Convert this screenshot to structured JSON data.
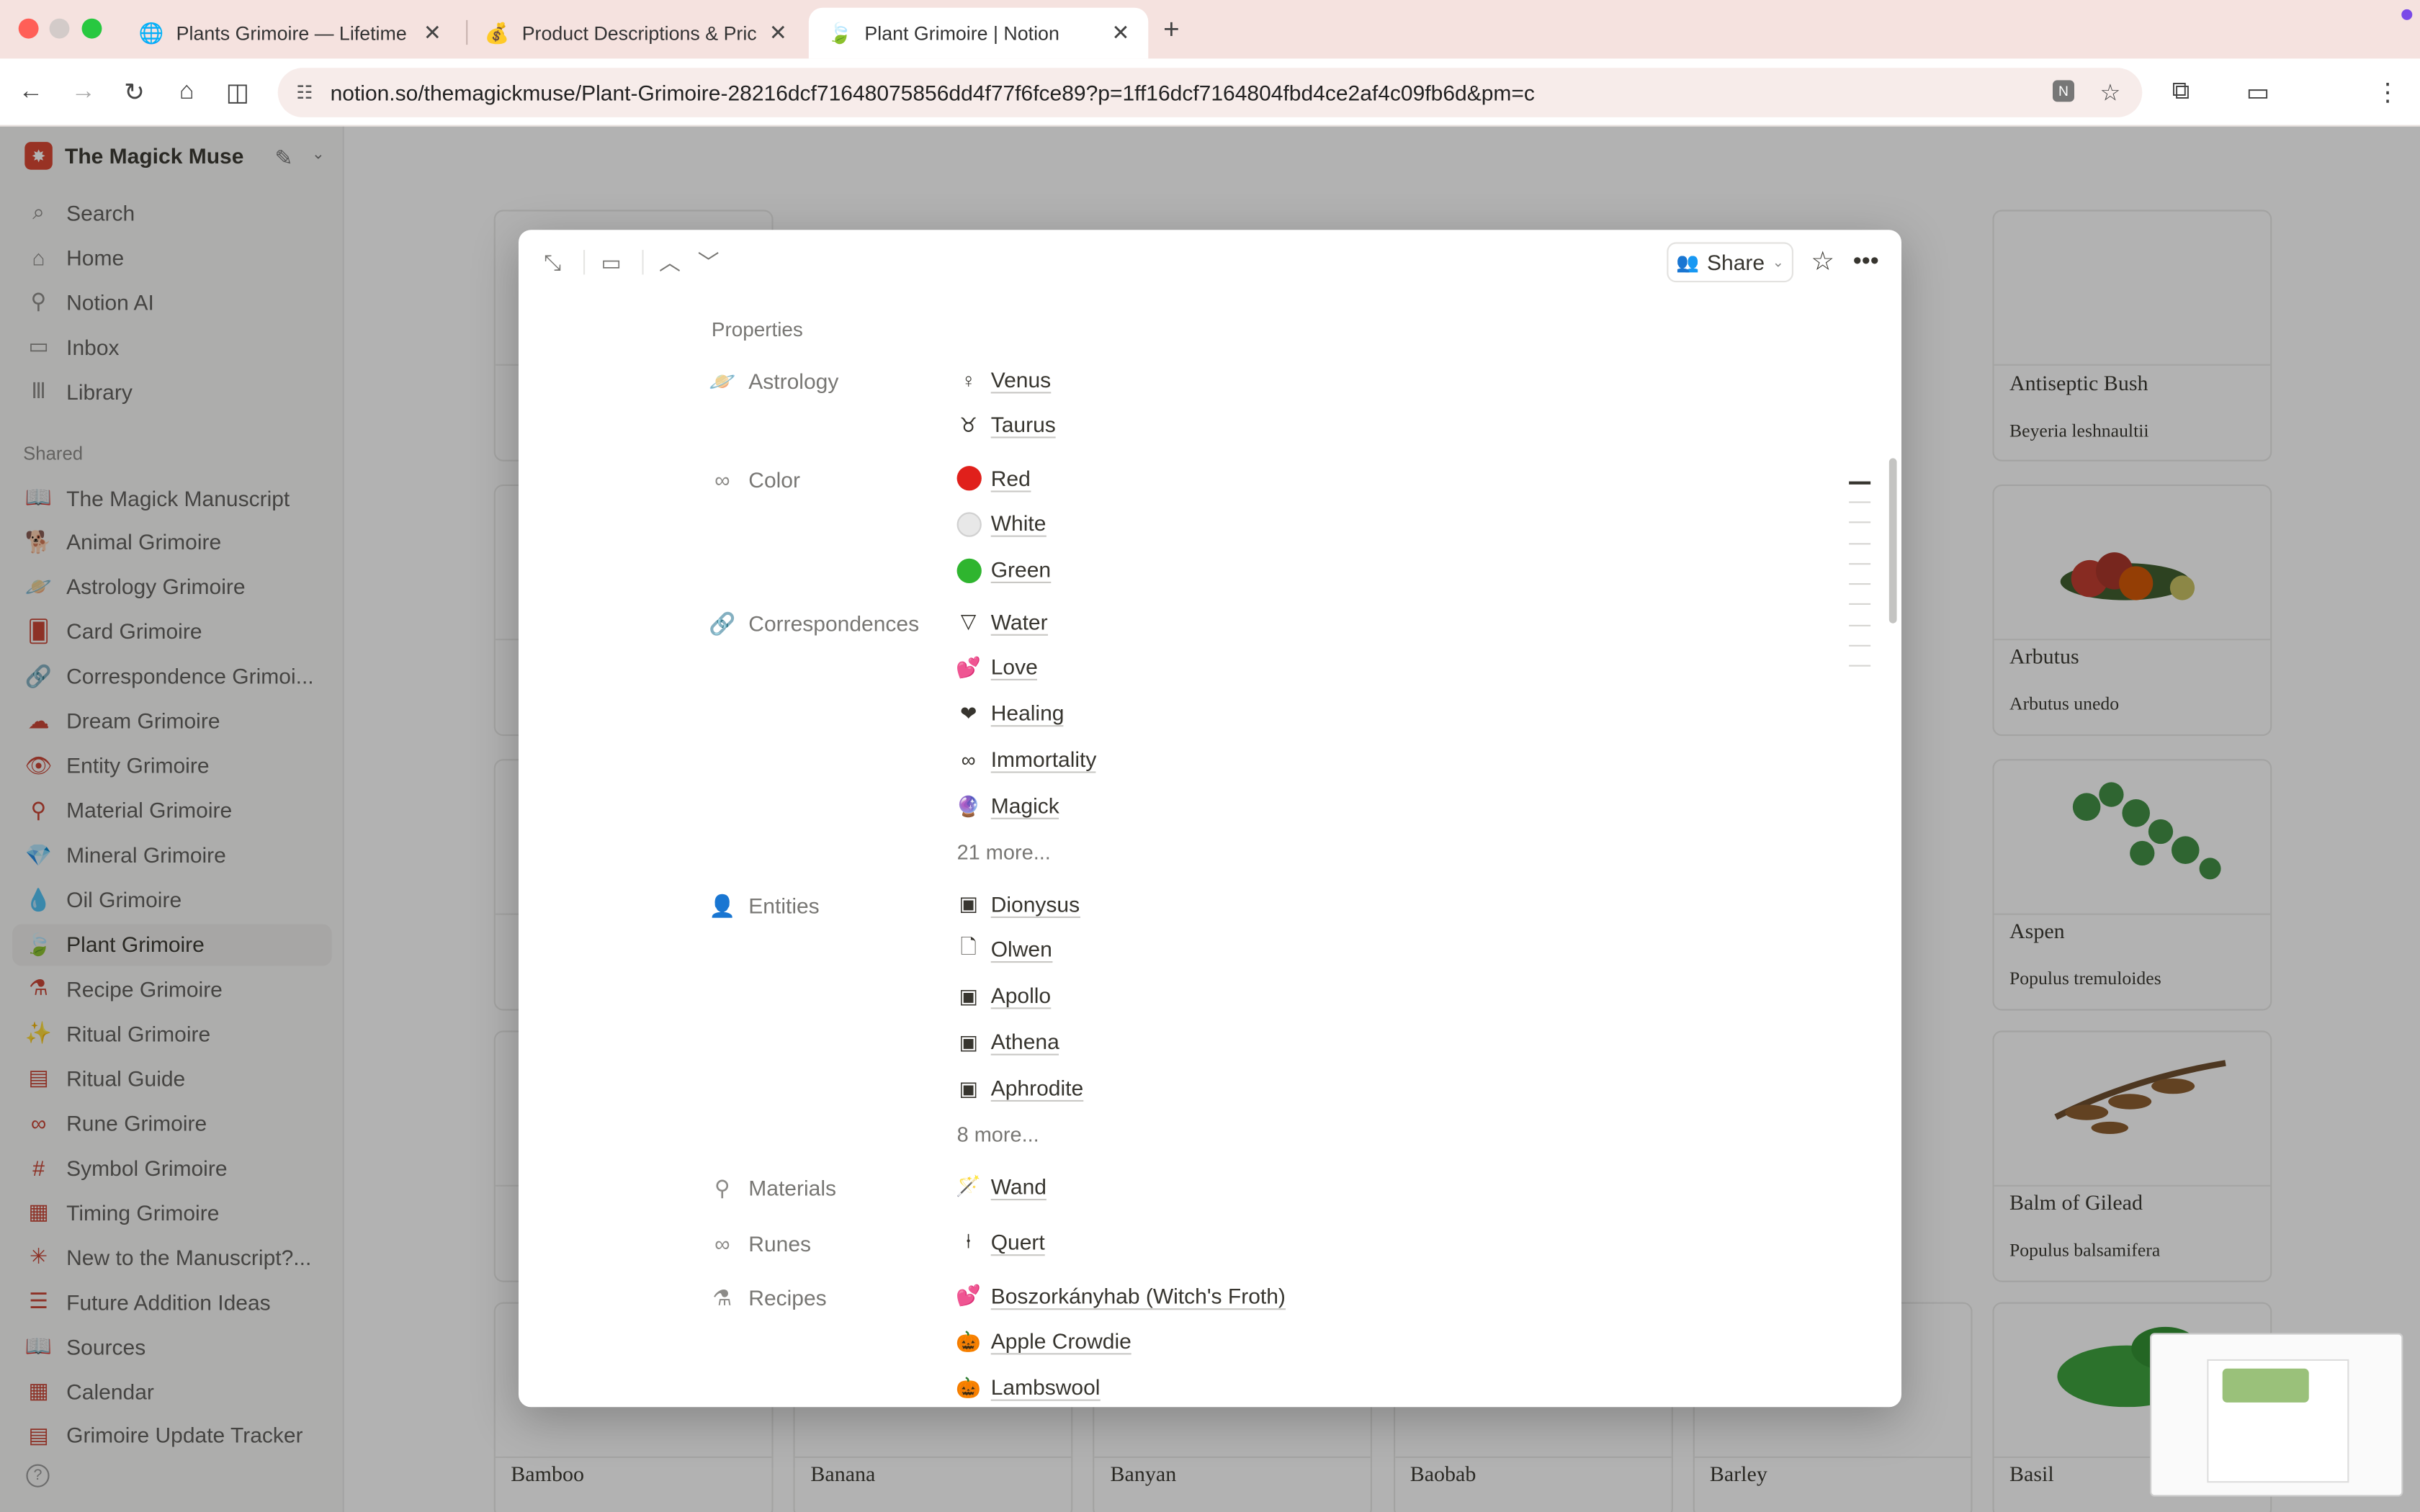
{
  "browser": {
    "tabs": [
      {
        "title": "Plants Grimoire — Lifetime Ac",
        "icon": "globe-icon"
      },
      {
        "title": "Product Descriptions & Pricin",
        "icon": "money-bag-icon"
      },
      {
        "title": "Plant Grimoire | Notion",
        "icon": "leaf-icon"
      }
    ],
    "url": "notion.so/themagickmuse/Plant-Grimoire-28216dcf71648075856dd4f77f6fce89?p=1ff16dcf7164804fbd4ce2af4c09fb6d&pm=c"
  },
  "sidebar": {
    "workspace": "The Magick Muse",
    "nav": [
      {
        "label": "Search",
        "icon": "search-icon",
        "glyph": "⌕"
      },
      {
        "label": "Home",
        "icon": "home-icon",
        "glyph": "⌂"
      },
      {
        "label": "Notion AI",
        "icon": "ai-icon",
        "glyph": "⚲"
      },
      {
        "label": "Inbox",
        "icon": "inbox-icon",
        "glyph": "▭"
      },
      {
        "label": "Library",
        "icon": "library-icon",
        "glyph": "Ⅲ"
      }
    ],
    "shared_label": "Shared",
    "pages": [
      {
        "label": "The Magick Manuscript",
        "icon": "book-icon",
        "glyph": "📖"
      },
      {
        "label": "Animal Grimoire",
        "icon": "animal-icon",
        "glyph": "🐕"
      },
      {
        "label": "Astrology Grimoire",
        "icon": "planet-icon",
        "glyph": "🪐"
      },
      {
        "label": "Card Grimoire",
        "icon": "card-icon",
        "glyph": "🂠"
      },
      {
        "label": "Correspondence Grimoi...",
        "icon": "link-icon",
        "glyph": "🔗"
      },
      {
        "label": "Dream Grimoire",
        "icon": "cloud-icon",
        "glyph": "☁"
      },
      {
        "label": "Entity Grimoire",
        "icon": "eye-icon",
        "glyph": "👁"
      },
      {
        "label": "Material Grimoire",
        "icon": "wand-icon",
        "glyph": "⚲"
      },
      {
        "label": "Mineral Grimoire",
        "icon": "gem-icon",
        "glyph": "💎"
      },
      {
        "label": "Oil Grimoire",
        "icon": "drop-icon",
        "glyph": "💧"
      },
      {
        "label": "Plant Grimoire",
        "icon": "leaf-icon",
        "glyph": "🍃",
        "selected": true
      },
      {
        "label": "Recipe Grimoire",
        "icon": "flask-icon",
        "glyph": "⚗"
      },
      {
        "label": "Ritual Grimoire",
        "icon": "magic-wand-icon",
        "glyph": "✨"
      },
      {
        "label": "Ritual Guide",
        "icon": "page-icon",
        "glyph": "▤"
      },
      {
        "label": "Rune Grimoire",
        "icon": "infinity-icon",
        "glyph": "∞"
      },
      {
        "label": "Symbol Grimoire",
        "icon": "hash-icon",
        "glyph": "#"
      },
      {
        "label": "Timing Grimoire",
        "icon": "calendar-icon",
        "glyph": "▦"
      },
      {
        "label": "New to the Manuscript?...",
        "icon": "sparkle-icon",
        "glyph": "✳"
      },
      {
        "label": "Future Addition Ideas",
        "icon": "list-icon",
        "glyph": "☰"
      },
      {
        "label": "Sources",
        "icon": "open-book-icon",
        "glyph": "📖"
      },
      {
        "label": "Calendar",
        "icon": "calendar-icon",
        "glyph": "▦"
      },
      {
        "label": "Grimoire Update Tracker",
        "icon": "table-icon",
        "glyph": "▤"
      }
    ]
  },
  "gallery": {
    "right_cards": [
      {
        "title": "Antiseptic Bush",
        "sub": "Beyeria leshnaultii"
      },
      {
        "title": "Arbutus",
        "sub": "Arbutus unedo"
      },
      {
        "title": "Aspen",
        "sub": "Populus tremuloides"
      },
      {
        "title": "Balm of Gilead",
        "sub": "Populus balsamifera"
      }
    ],
    "bottom_cards": [
      "Bamboo",
      "Banana",
      "Banyan",
      "Baobab",
      "Barley",
      "Basil"
    ]
  },
  "modal": {
    "share_label": "Share",
    "properties_heading": "Properties",
    "properties": [
      {
        "label": "Astrology",
        "icon": "planet-icon",
        "glyph": "🪐",
        "values": [
          {
            "text": "Venus",
            "glyph": "♀",
            "icon": "venus-icon"
          },
          {
            "text": "Taurus",
            "glyph": "♉",
            "icon": "taurus-icon"
          }
        ]
      },
      {
        "label": "Color",
        "icon": "infinity-icon",
        "glyph": "∞",
        "values": [
          {
            "text": "Red",
            "color": "#e0201b",
            "icon": "red-circle-icon"
          },
          {
            "text": "White",
            "color": "#e8e8e8",
            "icon": "white-circle-icon"
          },
          {
            "text": "Green",
            "color": "#2fb52f",
            "icon": "green-circle-icon"
          }
        ]
      },
      {
        "label": "Correspondences",
        "icon": "link-icon",
        "glyph": "🔗",
        "values": [
          {
            "text": "Water",
            "glyph": "▽",
            "icon": "water-triangle-icon"
          },
          {
            "text": "Love",
            "glyph": "💕",
            "icon": "hearts-icon"
          },
          {
            "text": "Healing",
            "glyph": "❤",
            "icon": "mending-heart-icon"
          },
          {
            "text": "Immortality",
            "glyph": "∞",
            "icon": "infinity-icon"
          },
          {
            "text": "Magick",
            "glyph": "🔮",
            "icon": "crystal-ball-icon"
          }
        ],
        "more": "21 more..."
      },
      {
        "label": "Entities",
        "icon": "person-icon",
        "glyph": "👤",
        "values": [
          {
            "text": "Dionysus",
            "glyph": "▣",
            "icon": "portrait-icon"
          },
          {
            "text": "Olwen",
            "glyph": "🗋",
            "icon": "page-icon"
          },
          {
            "text": "Apollo",
            "glyph": "▣",
            "icon": "portrait-icon"
          },
          {
            "text": "Athena",
            "glyph": "▣",
            "icon": "portrait-icon"
          },
          {
            "text": "Aphrodite",
            "glyph": "▣",
            "icon": "portrait-icon"
          }
        ],
        "more": "8 more..."
      },
      {
        "label": "Materials",
        "icon": "wand-icon",
        "glyph": "⚲",
        "values": [
          {
            "text": "Wand",
            "glyph": "🪄",
            "icon": "wand-icon"
          }
        ]
      },
      {
        "label": "Runes",
        "icon": "infinity-icon",
        "glyph": "∞",
        "values": [
          {
            "text": "Quert",
            "glyph": "⍿",
            "icon": "rune-icon"
          }
        ]
      },
      {
        "label": "Recipes",
        "icon": "flask-icon",
        "glyph": "⚗",
        "values": [
          {
            "text": "Boszorkányhab (Witch's Froth)",
            "glyph": "💕",
            "icon": "hearts-icon"
          },
          {
            "text": "Apple Crowdie",
            "glyph": "🎃",
            "icon": "pumpkin-icon"
          },
          {
            "text": "Lambswool",
            "glyph": "🎃",
            "icon": "pumpkin-icon"
          }
        ]
      }
    ]
  }
}
